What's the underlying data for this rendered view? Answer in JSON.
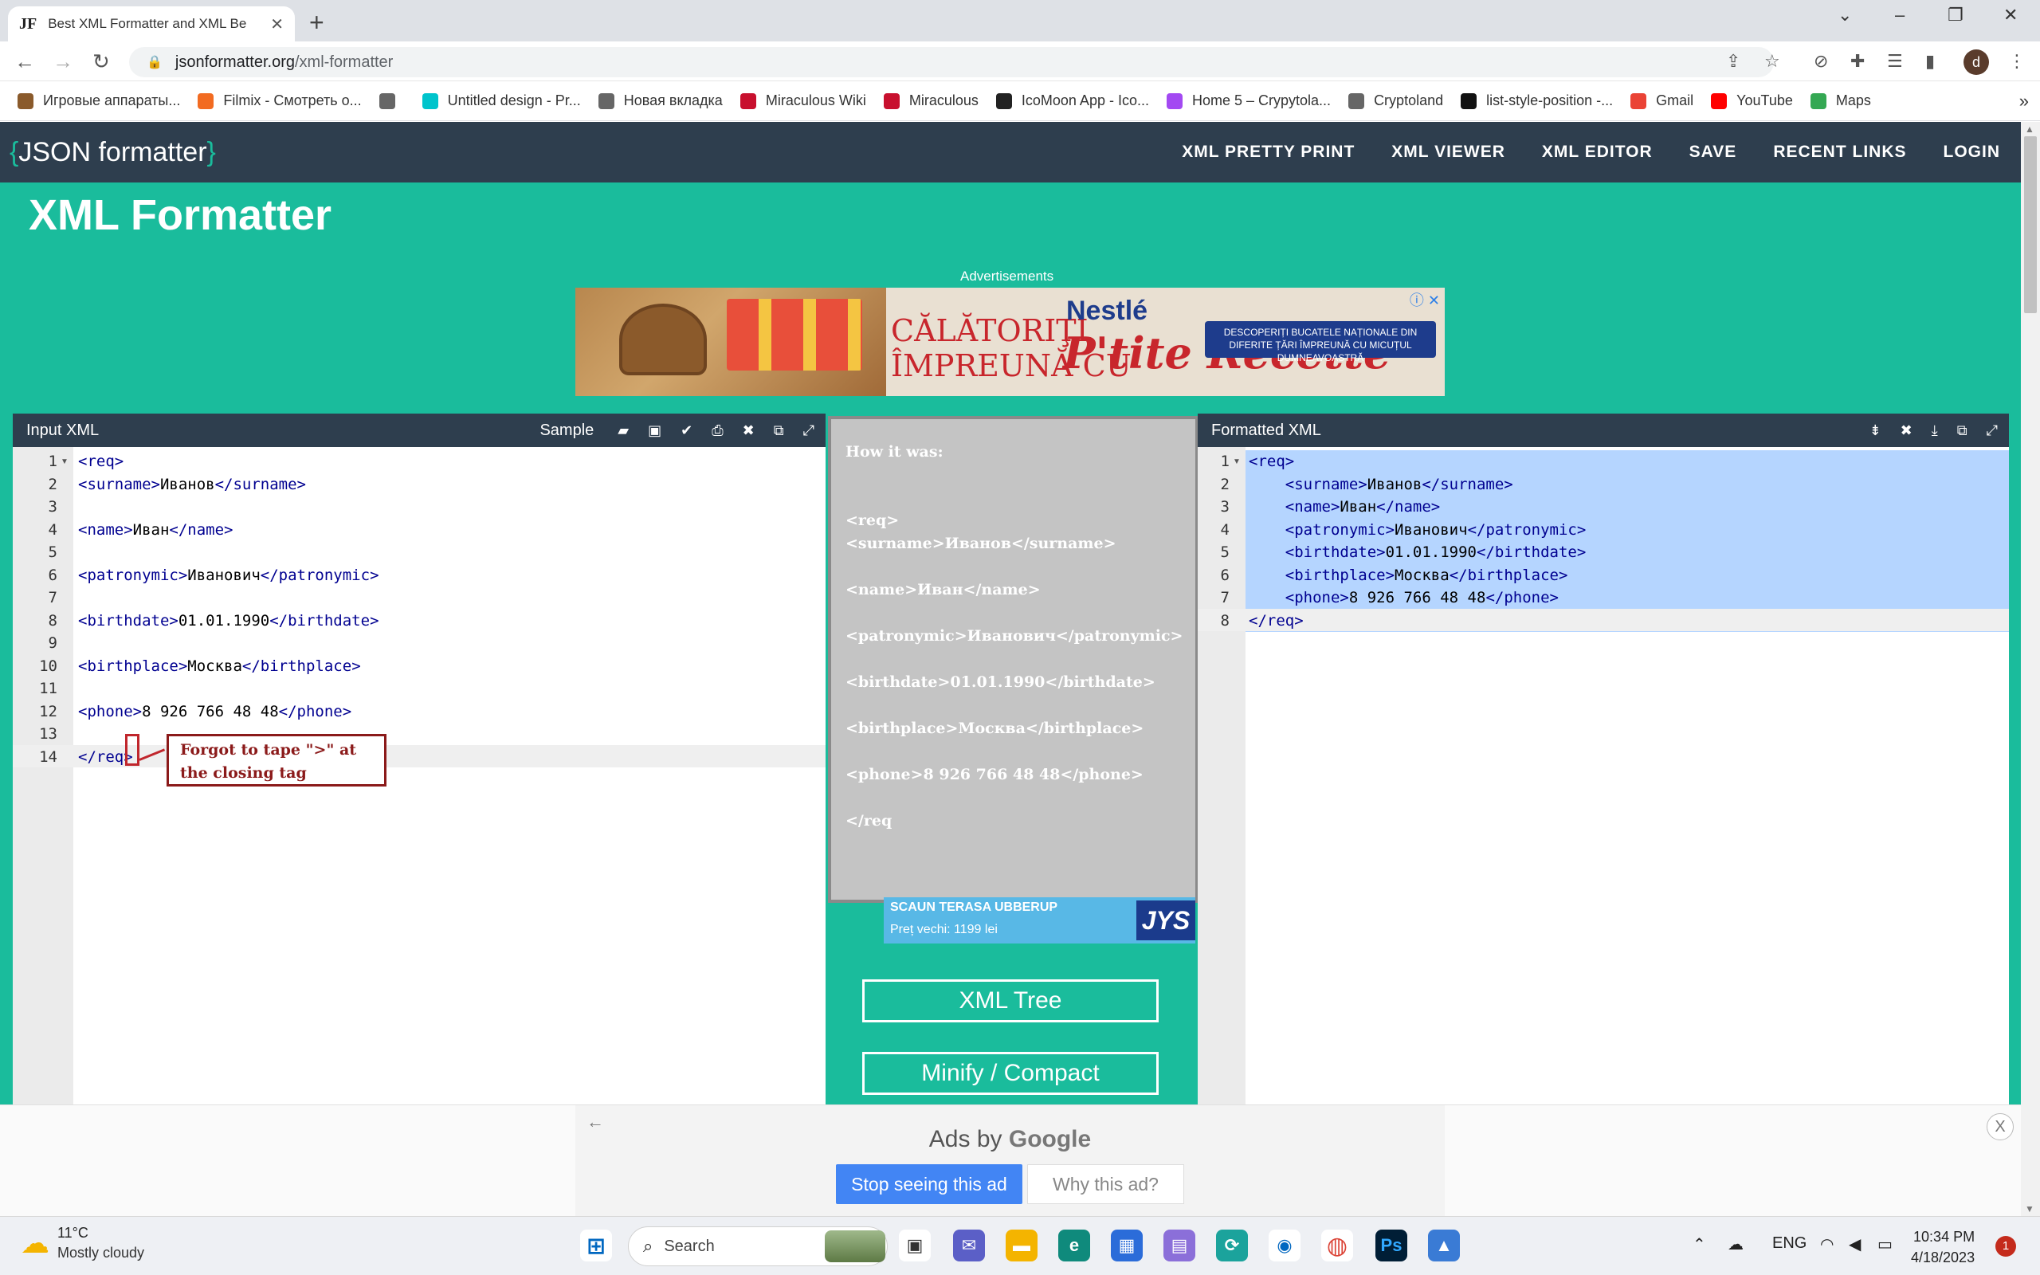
{
  "browser": {
    "tab_title": "Best XML Formatter and XML Be",
    "tab_favicon": "JF",
    "url_host": "jsonformatter.org",
    "url_path": "/xml-formatter",
    "profile_initial": "d",
    "bookmarks": [
      {
        "label": "Игровые аппараты...",
        "icon": "game-icon",
        "color": "#8a5a2b"
      },
      {
        "label": "Filmix - Смотреть о...",
        "icon": "filmix-icon",
        "color": "#f26b21"
      },
      {
        "label": "",
        "icon": "globe-icon",
        "color": "#666666"
      },
      {
        "label": "Untitled design - Pr...",
        "icon": "canva-icon",
        "color": "#00c4cc"
      },
      {
        "label": "Новая вкладка",
        "icon": "globe-icon",
        "color": "#666666"
      },
      {
        "label": "Miraculous Wiki",
        "icon": "ladybug-icon",
        "color": "#c8102e"
      },
      {
        "label": "Miraculous",
        "icon": "ladybug-icon",
        "color": "#c8102e"
      },
      {
        "label": "IcoMoon App - Ico...",
        "icon": "icomoon-icon",
        "color": "#222222"
      },
      {
        "label": "Home 5 – Crypytola...",
        "icon": "ring-icon",
        "color": "#a349f2"
      },
      {
        "label": "Cryptoland",
        "icon": "globe-icon",
        "color": "#666666"
      },
      {
        "label": "list-style-position -...",
        "icon": "mdn-icon",
        "color": "#111111"
      },
      {
        "label": "Gmail",
        "icon": "gmail-icon",
        "color": "#ea4335"
      },
      {
        "label": "YouTube",
        "icon": "youtube-icon",
        "color": "#ff0000"
      },
      {
        "label": "Maps",
        "icon": "maps-icon",
        "color": "#34a853"
      }
    ],
    "bookmarks_overflow": "»"
  },
  "site": {
    "logo_left_brace": "{",
    "logo_text": "JSON formatter",
    "logo_right_brace": "}",
    "nav": [
      "XML PRETTY PRINT",
      "XML VIEWER",
      "XML EDITOR",
      "SAVE",
      "RECENT LINKS",
      "LOGIN"
    ],
    "page_title": "XML Formatter",
    "ads_label": "Advertisements",
    "ad_banner": {
      "line1": "CĂLĂTORIŢI",
      "line2": "ÎMPREUNĂ CU",
      "brand": "Nestlé",
      "product": "P'tite Recette",
      "ribbon": "DESCOPERIȚI BUCATELE NAȚIONALE DIN DIFERITE ȚĂRI ÎMPREUNĂ CU MICUȚUL DUMNEAVOASTRĂ"
    }
  },
  "input_panel": {
    "title": "Input XML",
    "sample_label": "Sample",
    "tool_icons": [
      "folder-open-icon",
      "save-icon",
      "check-icon",
      "print-icon",
      "clear-icon",
      "copy-icon",
      "fullscreen-icon"
    ],
    "lines": [
      {
        "n": "1",
        "text": "<req>",
        "fold": true
      },
      {
        "n": "2",
        "text": "<surname>Иванов</surname>"
      },
      {
        "n": "3",
        "text": ""
      },
      {
        "n": "4",
        "text": "<name>Иван</name>"
      },
      {
        "n": "5",
        "text": ""
      },
      {
        "n": "6",
        "text": "<patronymic>Иванович</patronymic>"
      },
      {
        "n": "7",
        "text": ""
      },
      {
        "n": "8",
        "text": "<birthdate>01.01.1990</birthdate>"
      },
      {
        "n": "9",
        "text": ""
      },
      {
        "n": "10",
        "text": "<birthplace>Москва</birthplace>"
      },
      {
        "n": "11",
        "text": ""
      },
      {
        "n": "12",
        "text": "<phone>8 926 766 48 48</phone>"
      },
      {
        "n": "13",
        "text": ""
      },
      {
        "n": "14",
        "text": "</req>"
      }
    ],
    "annotation": "Forgot to tape \">\" at the closing tag"
  },
  "how_it_was": {
    "heading": "How it was:",
    "lines": [
      "<req>",
      "<surname>Иванов</surname>",
      "",
      "<name>Иван</name>",
      "",
      "<patronymic>Иванович</patronymic>",
      "",
      "<birthdate>01.01.1990</birthdate>",
      "",
      "<birthplace>Москва</birthplace>",
      "",
      "<phone>8 926 766 48 48</phone>",
      "",
      "</req"
    ]
  },
  "middle_ad": {
    "title": "SCAUN TERASA UBBERUP",
    "price": "Preț vechi: 1199 lei",
    "logo": "JYS"
  },
  "middle_buttons": [
    "XML Tree",
    "Minify / Compact"
  ],
  "output_panel": {
    "title": "Formatted XML",
    "tool_icons": [
      "tree-icon",
      "clear-icon",
      "download-icon",
      "copy-icon",
      "fullscreen-icon"
    ],
    "lines": [
      {
        "n": "1",
        "text": "<req>",
        "fold": true
      },
      {
        "n": "2",
        "text": "    <surname>Иванов</surname>"
      },
      {
        "n": "3",
        "text": "    <name>Иван</name>"
      },
      {
        "n": "4",
        "text": "    <patronymic>Иванович</patronymic>"
      },
      {
        "n": "5",
        "text": "    <birthdate>01.01.1990</birthdate>"
      },
      {
        "n": "6",
        "text": "    <birthplace>Москва</birthplace>"
      },
      {
        "n": "7",
        "text": "    <phone>8 926 766 48 48</phone>"
      },
      {
        "n": "8",
        "text": "</req>"
      }
    ]
  },
  "bottom_ad": {
    "ads_by": "Ads by",
    "google": "Google",
    "stop_label": "Stop seeing this ad",
    "why_label": "Why this ad?",
    "close_label": "X",
    "back_label": "←"
  },
  "taskbar": {
    "temp": "11°C",
    "weather": "Mostly cloudy",
    "search_placeholder": "Search",
    "lang": "ENG",
    "time": "10:34 PM",
    "date": "4/18/2023",
    "notifications": "1"
  }
}
